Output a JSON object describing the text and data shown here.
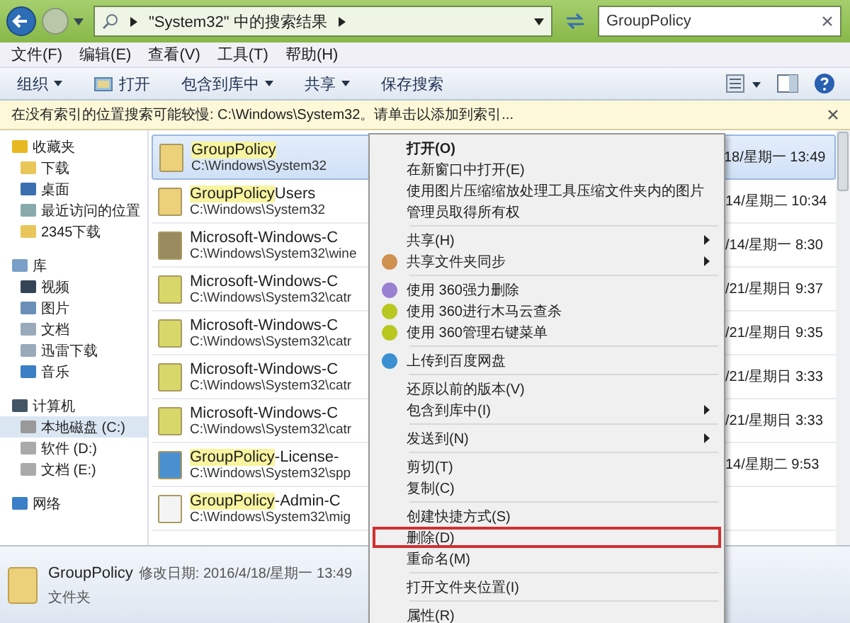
{
  "address": {
    "crumb": "\"System32\" 中的搜索结果"
  },
  "search": {
    "value": "GroupPolicy"
  },
  "menubar": [
    "文件(F)",
    "编辑(E)",
    "查看(V)",
    "工具(T)",
    "帮助(H)"
  ],
  "toolbar": [
    {
      "label": "组织",
      "dropdown": true
    },
    {
      "label": "打开",
      "dropdown": false
    },
    {
      "label": "包含到库中",
      "dropdown": true
    },
    {
      "label": "共享",
      "dropdown": true
    },
    {
      "label": "保存搜索",
      "dropdown": false
    }
  ],
  "infobar": {
    "text": "在没有索引的位置搜索可能较慢: C:\\Windows\\System32。请单击以添加到索引..."
  },
  "sidebar": [
    {
      "label": "收藏夹",
      "selected": false,
      "children": [
        {
          "label": "下载",
          "selected": false
        },
        {
          "label": "桌面",
          "selected": false
        },
        {
          "label": "最近访问的位置",
          "selected": false
        },
        {
          "label": "2345下载",
          "selected": false
        }
      ]
    },
    {
      "label": "库",
      "selected": false,
      "children": [
        {
          "label": "视频",
          "selected": false
        },
        {
          "label": "图片",
          "selected": false
        },
        {
          "label": "文档",
          "selected": false
        },
        {
          "label": "迅雷下载",
          "selected": false
        },
        {
          "label": "音乐",
          "selected": false
        }
      ]
    },
    {
      "label": "计算机",
      "selected": false,
      "children": [
        {
          "label": "本地磁盘 (C:)",
          "selected": true
        },
        {
          "label": "软件 (D:)",
          "selected": false
        },
        {
          "label": "文档 (E:)",
          "selected": false
        }
      ]
    },
    {
      "label": "网络",
      "selected": false
    }
  ],
  "results": [
    {
      "kind": "folder",
      "match": "GroupPolicy",
      "path": "C:\\Windows\\System32",
      "date": "18/星期一 13:49",
      "selected": true
    },
    {
      "kind": "folder",
      "match": "GroupPolicy",
      "rest": "Users",
      "path": "C:\\Windows\\System32",
      "date": "14/星期二 10:34",
      "selected": false
    },
    {
      "kind": "security",
      "rest": "Microsoft-Windows-C",
      "path": "C:\\Windows\\System32\\wine",
      "date": "/14/星期一 8:30",
      "selected": false
    },
    {
      "kind": "cabinet",
      "rest": "Microsoft-Windows-C",
      "path": "C:\\Windows\\System32\\catr",
      "date": "/21/星期日 9:37",
      "selected": false
    },
    {
      "kind": "cabinet",
      "rest": "Microsoft-Windows-C",
      "path": "C:\\Windows\\System32\\catr",
      "date": "/21/星期日 9:35",
      "selected": false
    },
    {
      "kind": "cabinet",
      "rest": "Microsoft-Windows-C",
      "path": "C:\\Windows\\System32\\catr",
      "date": "/21/星期日 3:33",
      "selected": false
    },
    {
      "kind": "cabinet",
      "rest": "Microsoft-Windows-C",
      "path": "C:\\Windows\\System32\\catr",
      "date": "/21/星期日 3:33",
      "selected": false
    },
    {
      "kind": "web",
      "match": "GroupPolicy",
      "rest": "-License-",
      "path": "C:\\Windows\\System32\\spp",
      "date": "14/星期二 9:53",
      "selected": false
    },
    {
      "kind": "file",
      "match": "GroupPolicy",
      "rest": "-Admin-C",
      "path": "C:\\Windows\\System32\\mig",
      "selected": false
    }
  ],
  "context_menu": [
    {
      "kind": "item",
      "label": "打开(O)",
      "bold": true
    },
    {
      "kind": "item",
      "label": "在新窗口中打开(E)"
    },
    {
      "kind": "item",
      "label": "使用图片压缩缩放处理工具压缩文件夹内的图片"
    },
    {
      "kind": "item",
      "label": "管理员取得所有权"
    },
    {
      "kind": "separator"
    },
    {
      "kind": "item",
      "label": "共享(H)",
      "submenu": true
    },
    {
      "kind": "item",
      "label": "共享文件夹同步",
      "submenu": true
    },
    {
      "kind": "separator"
    },
    {
      "kind": "item",
      "label": "使用 360强力删除"
    },
    {
      "kind": "item",
      "label": "使用 360进行木马云查杀"
    },
    {
      "kind": "item",
      "label": "使用 360管理右键菜单"
    },
    {
      "kind": "separator"
    },
    {
      "kind": "item",
      "label": "上传到百度网盘"
    },
    {
      "kind": "separator"
    },
    {
      "kind": "item",
      "label": "还原以前的版本(V)"
    },
    {
      "kind": "item",
      "label": "包含到库中(I)",
      "submenu": true
    },
    {
      "kind": "separator"
    },
    {
      "kind": "item",
      "label": "发送到(N)",
      "submenu": true
    },
    {
      "kind": "separator"
    },
    {
      "kind": "item",
      "label": "剪切(T)"
    },
    {
      "kind": "item",
      "label": "复制(C)"
    },
    {
      "kind": "separator"
    },
    {
      "kind": "item",
      "label": "创建快捷方式(S)"
    },
    {
      "kind": "item",
      "label": "删除(D)",
      "marked": true
    },
    {
      "kind": "item",
      "label": "重命名(M)"
    },
    {
      "kind": "separator"
    },
    {
      "kind": "item",
      "label": "打开文件夹位置(I)"
    },
    {
      "kind": "separator"
    },
    {
      "kind": "item",
      "label": "属性(R)"
    }
  ],
  "details": {
    "name": "GroupPolicy",
    "modified": "修改日期: 2016/4/18/星期一 13:49",
    "type": "文件夹"
  }
}
